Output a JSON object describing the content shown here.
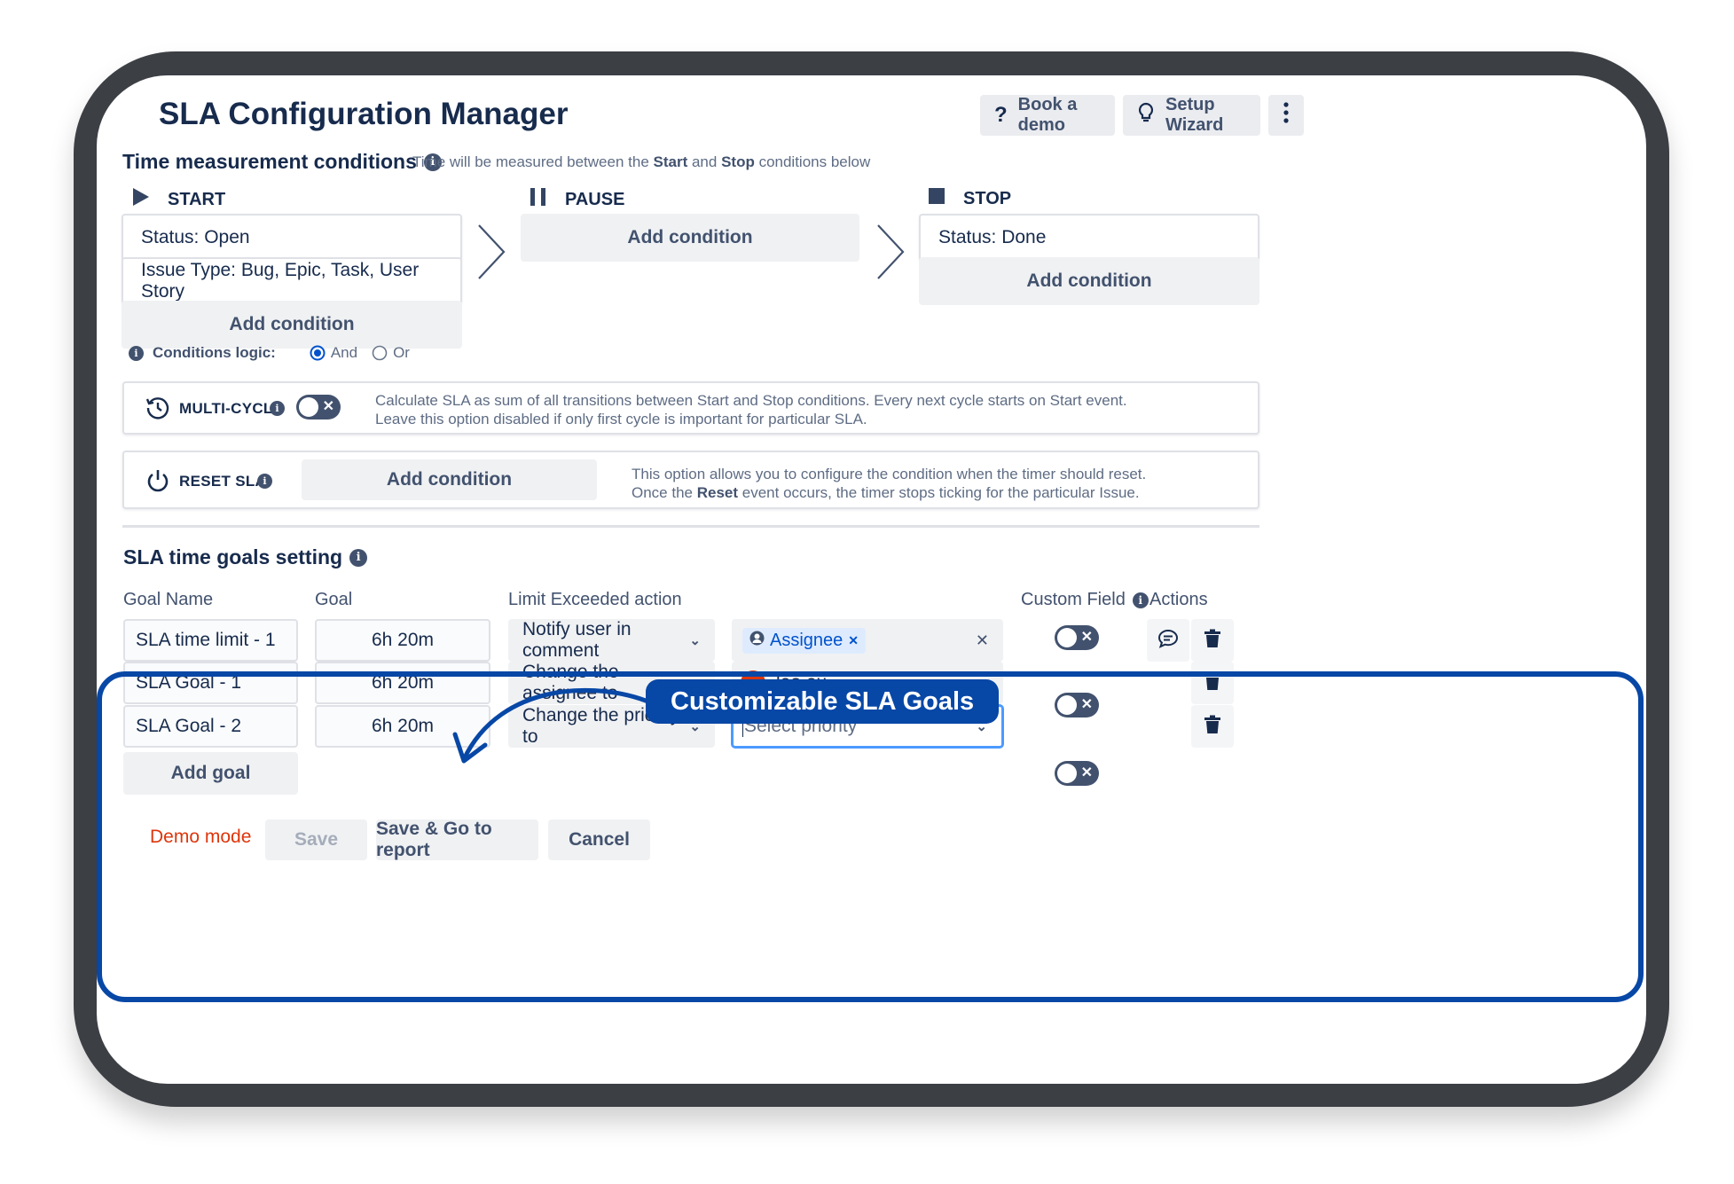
{
  "header": {
    "title": "SLA Configuration Manager",
    "book_demo": "Book a demo",
    "setup_wizard": "Setup Wizard"
  },
  "time_conditions": {
    "title": "Time measurement conditions",
    "hint_prefix": "Time will be measured between the ",
    "hint_start": "Start",
    "hint_and": " and ",
    "hint_stop": "Stop",
    "hint_suffix": " conditions below",
    "start": {
      "label": "START",
      "conditions": [
        "Status: Open",
        "Issue Type: Bug, Epic, Task, User Story"
      ],
      "add": "Add condition"
    },
    "pause": {
      "label": "PAUSE",
      "add": "Add condition"
    },
    "stop": {
      "label": "STOP",
      "conditions": [
        "Status: Done"
      ],
      "add": "Add condition"
    },
    "logic": {
      "label": "Conditions logic:",
      "and": "And",
      "or": "Or",
      "selected": "And"
    }
  },
  "multi_cycle": {
    "label": "MULTI-CYCLE",
    "enabled": false,
    "desc_line1": "Calculate SLA as sum of all transitions between Start and Stop conditions. Every next cycle starts on Start event.",
    "desc_line2": "Leave this option disabled if only first cycle is important for particular SLA."
  },
  "reset_sla": {
    "label": "RESET SLA",
    "add": "Add condition",
    "desc_line1": "This option allows you to configure the condition when the timer should reset.",
    "desc_line2_prefix": "Once the ",
    "desc_line2_bold": "Reset",
    "desc_line2_suffix": " event occurs, the timer stops ticking for the particular Issue."
  },
  "goals": {
    "title": "SLA time goals setting",
    "callout": "Customizable SLA Goals",
    "columns": {
      "goal_name": "Goal Name",
      "goal": "Goal",
      "action": "Limit Exceeded action",
      "custom_field": "Custom Field",
      "actions": "Actions"
    },
    "rows": [
      {
        "name": "SLA time limit - 1",
        "goal": "6h 20m",
        "action": "Notify user in comment",
        "target": "Assignee",
        "custom_field": false
      },
      {
        "name": "SLA Goal - 1",
        "goal": "6h 20m",
        "action": "Change the assignee to",
        "target": "leo.eu",
        "avatar_letter": "L",
        "custom_field": false
      },
      {
        "name": "SLA Goal - 2",
        "goal": "6h 20m",
        "action": "Change the priority to",
        "target_placeholder": "Select priority",
        "custom_field": false
      }
    ],
    "add_goal": "Add goal"
  },
  "footer": {
    "demo_mode": "Demo mode",
    "save": "Save",
    "save_report": "Save & Go to report",
    "cancel": "Cancel"
  },
  "colors": {
    "accent": "#0747a6",
    "demo_mode": "#de350b",
    "avatar": "#de350b",
    "chip_bg": "#deebff",
    "chip_text": "#0052cc"
  }
}
